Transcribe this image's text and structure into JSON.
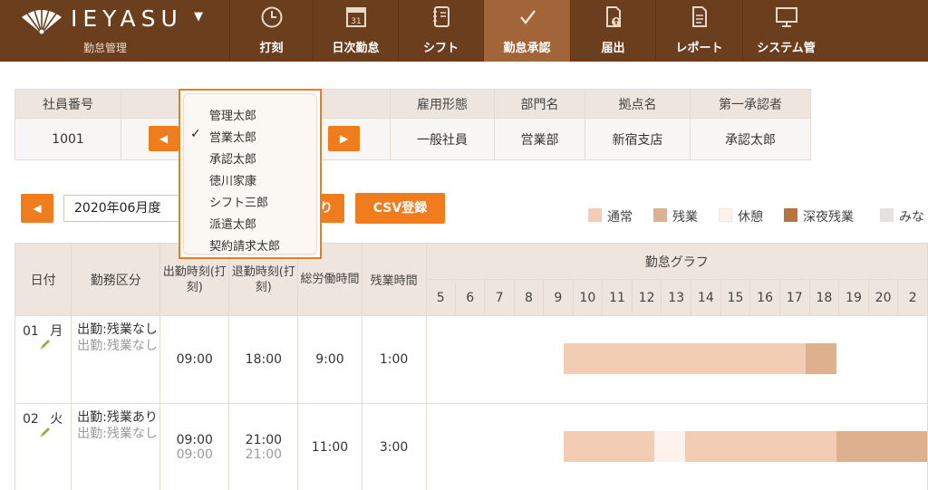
{
  "header": {
    "logo_text": "IEYASU",
    "logo_sub": "勤怠管理",
    "nav": [
      {
        "label": "打刻",
        "icon": "clock-icon"
      },
      {
        "label": "日次勤怠",
        "icon": "calendar-icon"
      },
      {
        "label": "シフト",
        "icon": "notebook-icon"
      },
      {
        "label": "勤怠承認",
        "icon": "checkmark-icon",
        "active": true
      },
      {
        "label": "届出",
        "icon": "document-upload-icon"
      },
      {
        "label": "レポート",
        "icon": "report-icon"
      },
      {
        "label": "システム管",
        "icon": "monitor-icon"
      }
    ]
  },
  "employee": {
    "headers": [
      "社員番号",
      "",
      "雇用形態",
      "部門名",
      "拠点名",
      "第一承認者"
    ],
    "values": {
      "number": "1001",
      "employment": "一般社員",
      "department": "営業部",
      "office": "新宿支店",
      "approver": "承認太郎"
    },
    "prev_glyph": "◀",
    "next_glyph": "▶"
  },
  "dropdown": {
    "items": [
      "管理太郎",
      "営業太郎",
      "承認太郎",
      "徳川家康",
      "シフト三郎",
      "派遣太郎",
      "契約請求太郎"
    ],
    "selected_index": 1,
    "check_glyph": "✓"
  },
  "month": {
    "value": "2020年06月度",
    "hidden_button_tail": "り",
    "csv_button": "CSV登録"
  },
  "legend": [
    {
      "label": "通常",
      "color": "#f2cdb4"
    },
    {
      "label": "残業",
      "color": "#ddb08e"
    },
    {
      "label": "休憩",
      "color": "#fdf2ec"
    },
    {
      "label": "深夜残業",
      "color": "#b8743f"
    },
    {
      "label": "みな",
      "color": "#e4e1df"
    }
  ],
  "table": {
    "headers": {
      "date": "日付",
      "kubun": "勤務区分",
      "start": "出勤時刻(打刻)",
      "end": "退勤時刻(打刻)",
      "total": "総労働時間",
      "overtime": "残業時間",
      "graph": "勤怠グラフ"
    },
    "hours": [
      "5",
      "6",
      "7",
      "8",
      "9",
      "10",
      "11",
      "12",
      "13",
      "14",
      "15",
      "16",
      "17",
      "18",
      "19",
      "20",
      "2"
    ],
    "rows": [
      {
        "day": "01",
        "weekday": "月",
        "kubun": "出勤:残業なし",
        "kubun_sub": "出勤:残業なし",
        "start": "09:00",
        "start_sub": "",
        "end": "18:00",
        "end_sub": "",
        "total": "9:00",
        "overtime": "1:00",
        "segments": [
          {
            "from": 9,
            "to": 17,
            "type": "通常"
          },
          {
            "from": 17,
            "to": 18,
            "type": "残業"
          }
        ]
      },
      {
        "day": "02",
        "weekday": "火",
        "kubun": "出勤:残業あり",
        "kubun_sub": "出勤:残業なし",
        "start": "09:00",
        "start_sub": "09:00",
        "end": "21:00",
        "end_sub": "21:00",
        "total": "11:00",
        "overtime": "3:00",
        "segments": [
          {
            "from": 9,
            "to": 12,
            "type": "通常"
          },
          {
            "from": 12,
            "to": 13,
            "type": "休憩"
          },
          {
            "from": 13,
            "to": 18,
            "type": "通常"
          },
          {
            "from": 18,
            "to": 21,
            "type": "残業"
          }
        ]
      }
    ]
  }
}
